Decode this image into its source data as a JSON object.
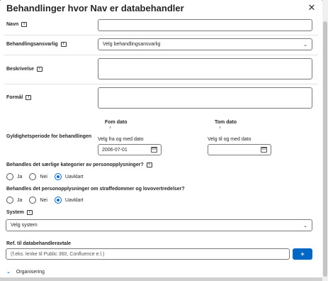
{
  "modal": {
    "title": "Behandlinger hvor Nav er databehandler",
    "close_label": "✕"
  },
  "fields": {
    "navn": {
      "label": "Navn",
      "value": ""
    },
    "behandlingsansvarlig": {
      "label": "Behandlingsansvarlig",
      "value": "Velg behandlingsansvarlig"
    },
    "beskrivelse": {
      "label": "Beskrivelse",
      "value": ""
    },
    "formal": {
      "label": "Formål",
      "value": ""
    }
  },
  "gyldighet": {
    "label": "Gyldighetsperiode for behandlingen",
    "fom_header": "Fom dato",
    "tom_header": "Tom dato",
    "fom_label": "Velg fra og med dato",
    "tom_label": "Velg til og med dato",
    "fom_value": "2006-07-01",
    "tom_value": ""
  },
  "saerlige": {
    "question": "Behandles det særlige kategorier av personopplysninger?",
    "options": [
      "Ja",
      "Nei",
      "Uavklart"
    ],
    "selected": "Uavklart"
  },
  "straffedommer": {
    "question": "Behandles det personopplysninger om straffedommer og lovovertredelser?",
    "options": [
      "Ja",
      "Nei",
      "Uavklart"
    ],
    "selected": "Uavklart"
  },
  "system": {
    "label": "System",
    "value": "Velg system"
  },
  "ref": {
    "label": "Ref. til databehandleravtale",
    "placeholder": "(f.eks. lenke til Public 360, Confluence e.l.)",
    "add_label": "+"
  },
  "accordion": {
    "label": "Organisering",
    "chevron": "⌄"
  },
  "icons": {
    "info": "i",
    "chevron_down": "⌄",
    "calendar": "calendar-icon"
  },
  "colors": {
    "accent": "#0067c5",
    "border": "#7a7a7a",
    "text": "#262626"
  }
}
